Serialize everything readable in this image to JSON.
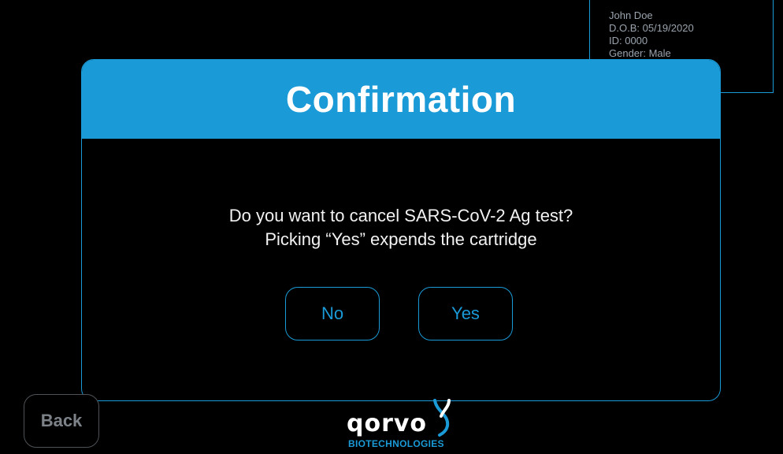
{
  "patient": {
    "name": "John Doe",
    "dob": "D.O.B: 05/19/2020",
    "id": "ID: 0000",
    "gender": "Gender: Male"
  },
  "dialog": {
    "title": "Confirmation",
    "message_line1": "Do you want to cancel SARS-CoV-2 Ag test?",
    "message_line2": "Picking “Yes” expends the cartridge",
    "no_label": "No",
    "yes_label": "Yes"
  },
  "footer": {
    "back_label": "Back",
    "logo_word": "qorvo",
    "logo_sub": "BIOTECHNOLOGIES",
    "logo_icon": "qorvo-helix-icon"
  },
  "colors": {
    "accent": "#1a9ad6",
    "background": "#000000",
    "back_border": "#4f5358"
  }
}
